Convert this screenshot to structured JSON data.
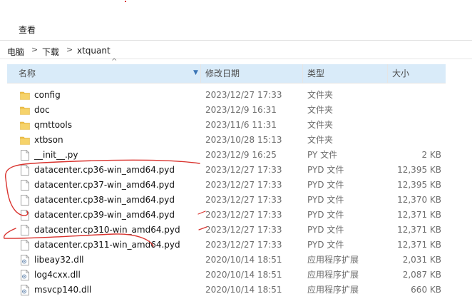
{
  "ribbon": {
    "view_tab": "查看"
  },
  "breadcrumb": {
    "items": [
      "电脑",
      "下载",
      "xtquant"
    ],
    "separator": ">"
  },
  "columns": {
    "name": "名称",
    "date": "修改日期",
    "type": "类型",
    "size": "大小"
  },
  "sort_arrow": "^",
  "colors": {
    "header_bg": "#d9ebf9",
    "folder": "#f0c24a",
    "annotation": "#d9332e"
  },
  "files": [
    {
      "name": "config",
      "date": "2023/12/27 17:33",
      "type": "文件夹",
      "size": "",
      "icon": "folder-icon"
    },
    {
      "name": "doc",
      "date": "2023/12/9 16:31",
      "type": "文件夹",
      "size": "",
      "icon": "folder-icon"
    },
    {
      "name": "qmttools",
      "date": "2023/11/6 11:31",
      "type": "文件夹",
      "size": "",
      "icon": "folder-icon"
    },
    {
      "name": "xtbson",
      "date": "2023/10/28 15:13",
      "type": "文件夹",
      "size": "",
      "icon": "folder-icon"
    },
    {
      "name": "__init__.py",
      "date": "2023/12/9 16:25",
      "type": "PY 文件",
      "size": "2 KB",
      "icon": "file-icon"
    },
    {
      "name": "datacenter.cp36-win_amd64.pyd",
      "date": "2023/12/27 17:33",
      "type": "PYD 文件",
      "size": "12,395 KB",
      "icon": "file-icon"
    },
    {
      "name": "datacenter.cp37-win_amd64.pyd",
      "date": "2023/12/27 17:33",
      "type": "PYD 文件",
      "size": "12,395 KB",
      "icon": "file-icon"
    },
    {
      "name": "datacenter.cp38-win_amd64.pyd",
      "date": "2023/12/27 17:33",
      "type": "PYD 文件",
      "size": "12,370 KB",
      "icon": "file-icon"
    },
    {
      "name": "datacenter.cp39-win_amd64.pyd",
      "date": "2023/12/27 17:33",
      "type": "PYD 文件",
      "size": "12,371 KB",
      "icon": "file-icon"
    },
    {
      "name": "datacenter.cp310-win_amd64.pyd",
      "date": "2023/12/27 17:33",
      "type": "PYD 文件",
      "size": "12,371 KB",
      "icon": "file-icon"
    },
    {
      "name": "datacenter.cp311-win_amd64.pyd",
      "date": "2023/12/27 17:33",
      "type": "PYD 文件",
      "size": "12,371 KB",
      "icon": "file-icon"
    },
    {
      "name": "libeay32.dll",
      "date": "2020/10/14 18:51",
      "type": "应用程序扩展",
      "size": "2,031 KB",
      "icon": "dll-icon"
    },
    {
      "name": "log4cxx.dll",
      "date": "2020/10/14 18:51",
      "type": "应用程序扩展",
      "size": "2,087 KB",
      "icon": "dll-icon"
    },
    {
      "name": "msvcp140.dll",
      "date": "2020/10/14 18:51",
      "type": "应用程序扩展",
      "size": "660 KB",
      "icon": "dll-icon"
    }
  ]
}
